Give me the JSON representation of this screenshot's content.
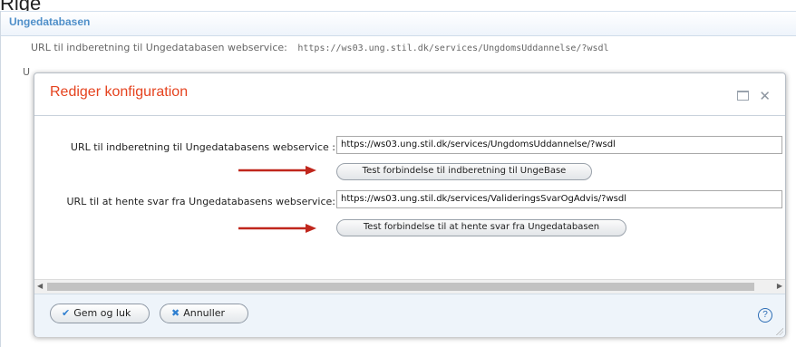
{
  "top_label": "Rige",
  "panel": {
    "title": "Ungedatabasen",
    "bg_row_label": "URL til indberetning til Ungedatabasen webservice:",
    "bg_row_url": "https://ws03.ung.stil.dk/services/UngdomsUddannelse/?wsdl",
    "bg_row2_letter": "U"
  },
  "dialog": {
    "title": "Rediger konfiguration",
    "fields": [
      {
        "label": "URL til indberetning til Ungedatabasens webservice :",
        "value": "https://ws03.ung.stil.dk/services/UngdomsUddannelse/?wsdl",
        "button": "Test forbindelse til indberetning til UngeBase"
      },
      {
        "label": "URL til at hente svar fra Ungedatabasens webservice:",
        "value": "https://ws03.ung.stil.dk/services/ValideringsSvarOgAdvis/?wsdl",
        "button": "Test forbindelse til at hente svar fra Ungedatabasen"
      }
    ],
    "footer": {
      "save_label": "Gem og luk",
      "cancel_label": "Annuller",
      "help_label": "?"
    }
  },
  "colors": {
    "title_red": "#e5431f",
    "panel_blue": "#4f8fc9",
    "arrow_red": "#c0261c",
    "icon_blue": "#2f7fd0"
  },
  "icons": {
    "maximize": "maximize-icon",
    "close": "close-icon",
    "save": "checkmark-icon",
    "cancel": "x-icon",
    "help": "help-icon"
  }
}
